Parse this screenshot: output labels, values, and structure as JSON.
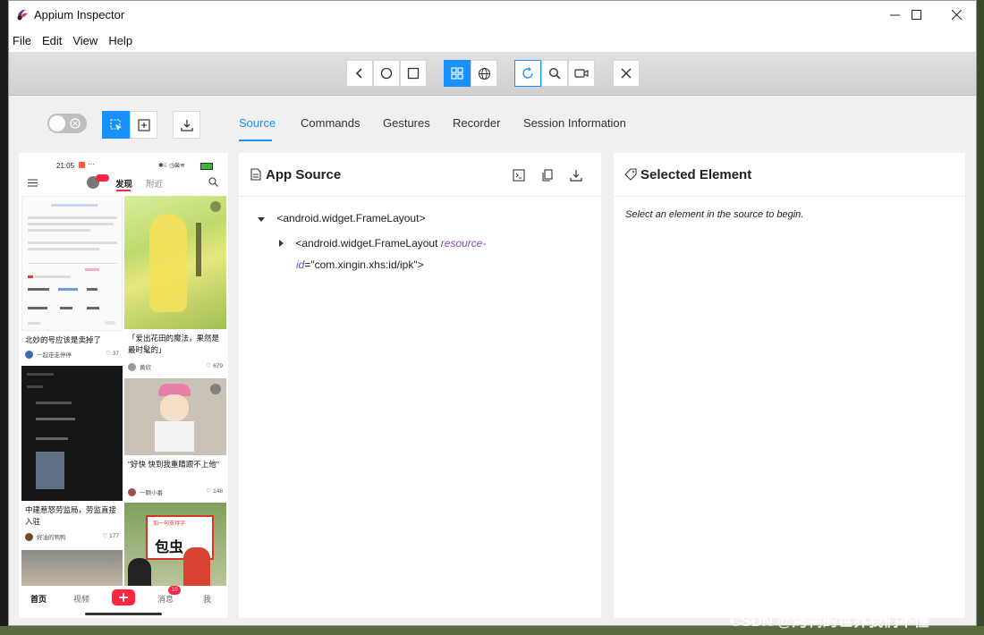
{
  "window": {
    "title": "Appium Inspector"
  },
  "menu": [
    "File",
    "Edit",
    "View",
    "Help"
  ],
  "tabs": {
    "source": "Source",
    "commands": "Commands",
    "gestures": "Gestures",
    "recorder": "Recorder",
    "session": "Session Information"
  },
  "app_source": {
    "title": "App Source",
    "node1": "<android.widget.FrameLayout>",
    "node2_tag": "<android.widget.FrameLayout",
    "node2_attr": "resource-",
    "node2_attr2": "id",
    "node2_val": "=\"com.xingin.xhs:id/ipk\">"
  },
  "selected": {
    "title": "Selected Element",
    "hint": "Select an element in the source to begin."
  },
  "phone": {
    "time": "21:05",
    "top_tabs": {
      "discover": "发现",
      "nearby": "附近"
    },
    "cards": [
      {
        "title": "北妙的号应该是卖掉了",
        "author": "一起走走停停",
        "likes": "37"
      },
      {
        "title": "「爱出花田的魔法，果然是最时髦的」",
        "author": "黄欣",
        "likes": "679"
      },
      {
        "title": "中建惹怒劳监局，劳监直接入驻",
        "author": "好油的鸭鸭",
        "likes": "177"
      },
      {
        "title": "\"好快 快到我重睛跟不上他\"",
        "author": "一颗小番",
        "likes": "148"
      }
    ],
    "img_text": {
      "banner": "加一句支持字",
      "big": "包虫"
    },
    "nav": {
      "home": "首页",
      "video": "视频",
      "msg": "消息",
      "me": "我",
      "badge": "10"
    }
  },
  "watermark": "CSDN @烤鸭的世界我们不懂",
  "colors": {
    "accent": "#1890ff",
    "red": "#ff2442"
  }
}
